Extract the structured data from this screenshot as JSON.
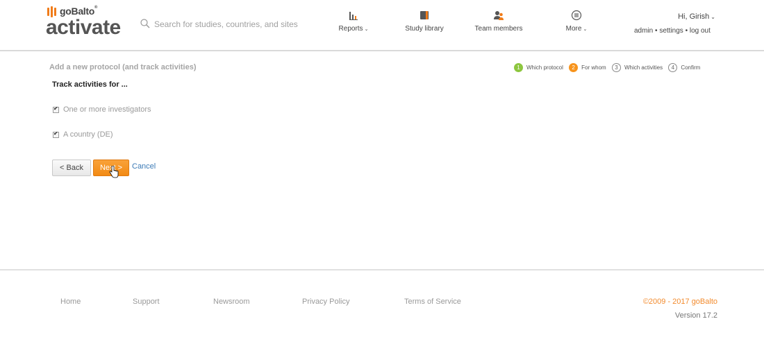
{
  "brand": {
    "top": "goBalto",
    "tm": "®",
    "bottom": "activate",
    "accent_color": "#f07c1a"
  },
  "search": {
    "placeholder": "Search for studies, countries, and sites",
    "icon": "search-icon"
  },
  "nav": [
    {
      "label": "Reports",
      "icon": "bar-chart-icon",
      "has_caret": true
    },
    {
      "label": "Study library",
      "icon": "book-icon",
      "has_caret": false
    },
    {
      "label": "Team members",
      "icon": "team-icon",
      "has_caret": false
    },
    {
      "label": "More",
      "icon": "menu-circle-icon",
      "has_caret": true
    }
  ],
  "user": {
    "greeting": "Hi, Girish",
    "links": [
      "admin",
      "settings",
      "log out"
    ],
    "separator": "•"
  },
  "page": {
    "title": "Add a new protocol (and track activities)",
    "steps": [
      {
        "number": "1",
        "label": "Which protocol",
        "state": "done"
      },
      {
        "number": "2",
        "label": "For whom",
        "state": "active"
      },
      {
        "number": "3",
        "label": "Which activities",
        "state": "todo"
      },
      {
        "number": "4",
        "label": "Confirm",
        "state": "todo"
      }
    ],
    "heading": "Track activities for ...",
    "options": [
      {
        "label": "One or more investigators",
        "checked": true
      },
      {
        "label": "A country (DE)",
        "checked": true
      }
    ],
    "buttons": {
      "back": "< Back",
      "next": "Next >",
      "cancel": "Cancel"
    }
  },
  "footer": {
    "links": [
      "Home",
      "Support",
      "Newsroom",
      "Privacy Policy",
      "Terms of Service"
    ],
    "copyright": "©2009 - 2017 goBalto",
    "version": "Version 17.2"
  },
  "colors": {
    "step_done": "#8dc63f",
    "step_active": "#f7941d",
    "next_button": "#f28a14",
    "link": "#3b7ab6"
  }
}
